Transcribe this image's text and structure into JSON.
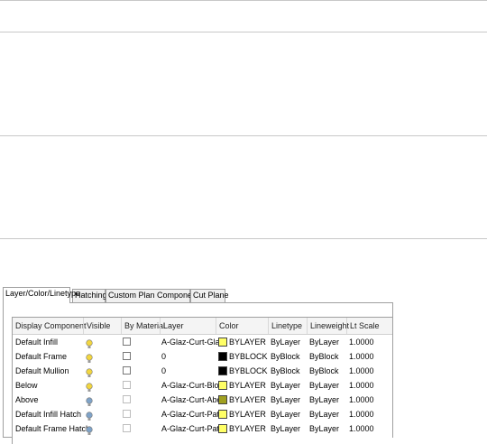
{
  "tabs": [
    {
      "label": "Layer/Color/Linetype",
      "active": true
    },
    {
      "label": "Hatching",
      "active": false
    },
    {
      "label": "Custom Plan Components",
      "active": false
    },
    {
      "label": "Cut Plane",
      "active": false
    }
  ],
  "columns": [
    "Display Component",
    "Visible",
    "By Material",
    "Layer",
    "Color",
    "Linetype",
    "Lineweight",
    "Lt Scale"
  ],
  "rows": [
    {
      "component": "Default Infill",
      "visible": true,
      "bulb_color": "#f2d640",
      "material_enabled": true,
      "layer": "A-Glaz-Curt-Glaz",
      "swatch": "#ffff66",
      "color": "BYLAYER",
      "linetype": "ByLayer",
      "lineweight": "ByLayer",
      "lt_scale": "1.0000"
    },
    {
      "component": "Default Frame",
      "visible": true,
      "bulb_color": "#f2d640",
      "material_enabled": true,
      "layer": "0",
      "swatch": "#000000",
      "color": "BYBLOCK",
      "linetype": "ByBlock",
      "lineweight": "ByBlock",
      "lt_scale": "1.0000"
    },
    {
      "component": "Default Mullion",
      "visible": true,
      "bulb_color": "#f2d640",
      "material_enabled": true,
      "layer": "0",
      "swatch": "#000000",
      "color": "BYBLOCK",
      "linetype": "ByBlock",
      "lineweight": "ByBlock",
      "lt_scale": "1.0000"
    },
    {
      "component": "Below",
      "visible": true,
      "bulb_color": "#f2d640",
      "material_enabled": false,
      "layer": "A-Glaz-Curt-Blow",
      "swatch": "#ffff66",
      "color": "BYLAYER",
      "linetype": "ByLayer",
      "lineweight": "ByLayer",
      "lt_scale": "1.0000"
    },
    {
      "component": "Above",
      "visible": false,
      "bulb_color": "#7fa3c8",
      "material_enabled": false,
      "layer": "A-Glaz-Curt-Abov",
      "swatch": "#a0a020",
      "color": "BYLAYER",
      "linetype": "ByLayer",
      "lineweight": "ByLayer",
      "lt_scale": "1.0000"
    },
    {
      "component": "Default Infill Hatch",
      "visible": false,
      "bulb_color": "#7fa3c8",
      "material_enabled": false,
      "layer": "A-Glaz-Curt-Patt",
      "swatch": "#ffff66",
      "color": "BYLAYER",
      "linetype": "ByLayer",
      "lineweight": "ByLayer",
      "lt_scale": "1.0000"
    },
    {
      "component": "Default Frame Hatch",
      "visible": false,
      "bulb_color": "#7fa3c8",
      "material_enabled": false,
      "layer": "A-Glaz-Curt-Patt",
      "swatch": "#ffff66",
      "color": "BYLAYER",
      "linetype": "ByLayer",
      "lineweight": "ByLayer",
      "lt_scale": "1.0000"
    }
  ]
}
